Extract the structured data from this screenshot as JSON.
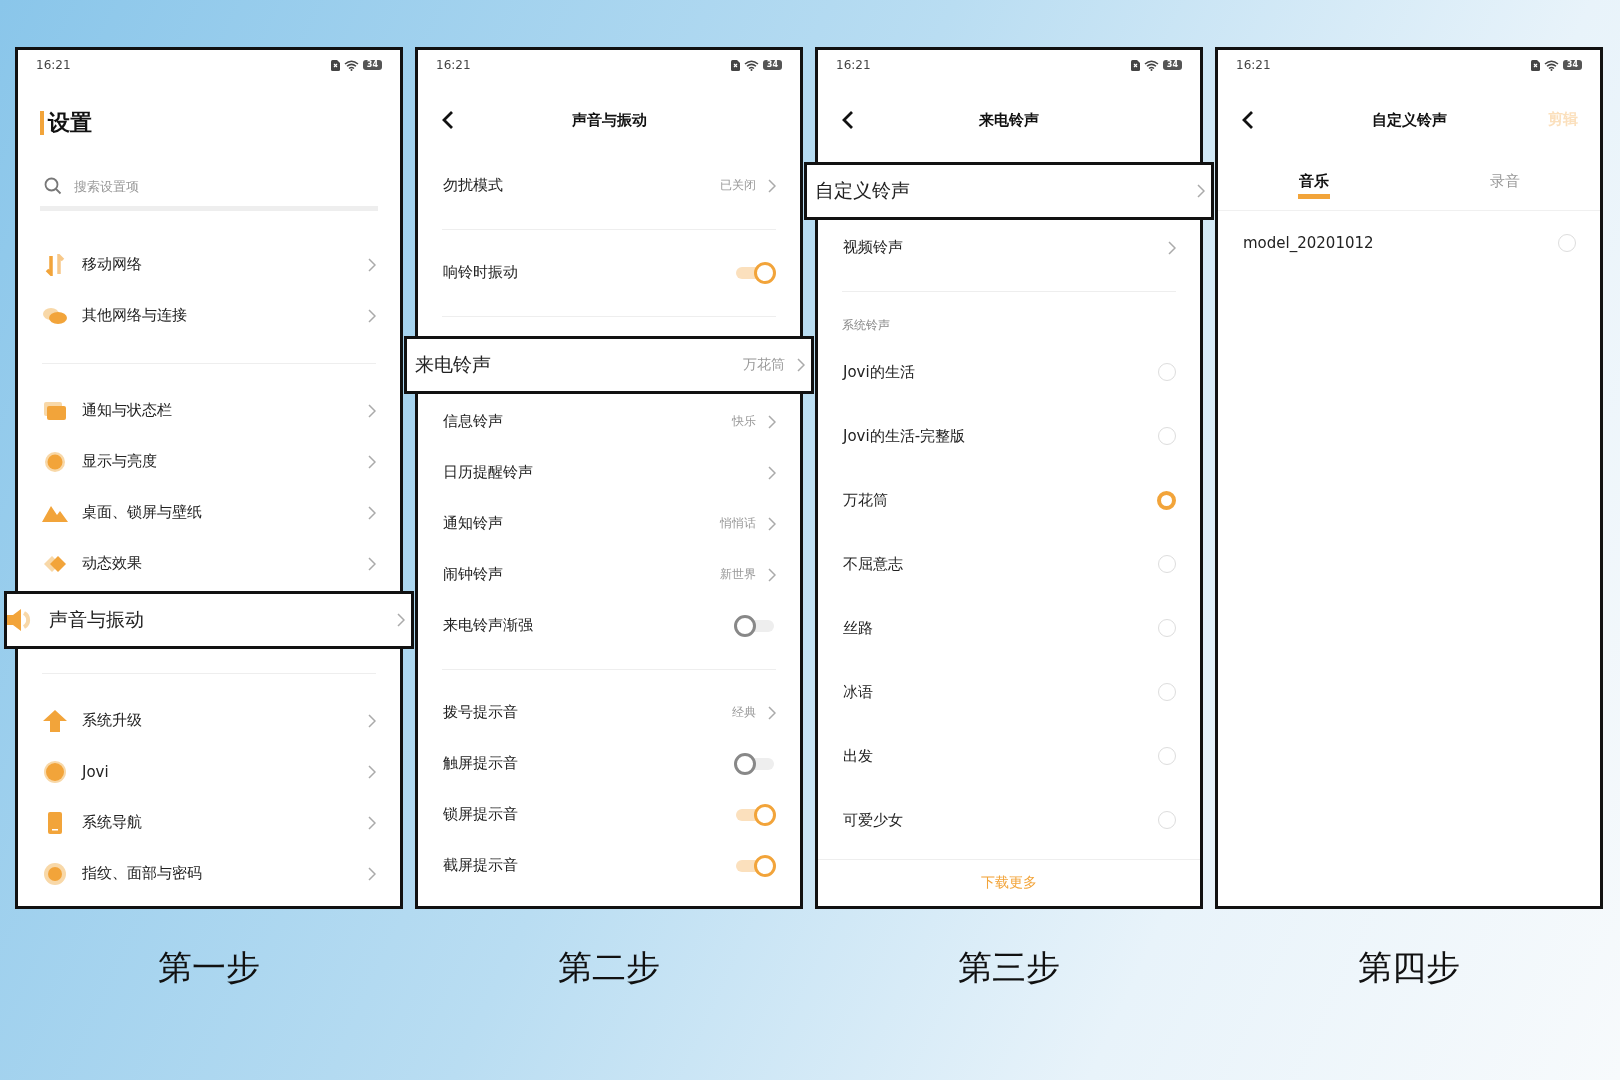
{
  "steps": [
    {
      "caption": "第一步",
      "phone": {
        "kind": "home",
        "status_bar": {
          "time": "16:21",
          "battery": "34"
        },
        "title": "设置",
        "search": {
          "placeholder": "搜索设置项"
        },
        "rows": [
          {
            "kind": "nav",
            "label": "移动网络",
            "highlighted": false
          },
          {
            "kind": "nav",
            "label": "其他网络与连接",
            "highlighted": false
          },
          {
            "kind": "divider"
          },
          {
            "kind": "nav",
            "label": "通知与状态栏",
            "highlighted": false
          },
          {
            "kind": "nav",
            "label": "显示与亮度",
            "highlighted": false
          },
          {
            "kind": "nav",
            "label": "桌面、锁屏与壁纸",
            "highlighted": false
          },
          {
            "kind": "nav",
            "label": "动态效果",
            "highlighted": false
          },
          {
            "kind": "nav",
            "label": "声音与振动",
            "highlighted": true
          },
          {
            "kind": "divider"
          },
          {
            "kind": "nav",
            "label": "系统升级",
            "highlighted": false
          },
          {
            "kind": "nav",
            "label": "Jovi",
            "highlighted": false
          },
          {
            "kind": "nav",
            "label": "系统导航",
            "highlighted": false
          },
          {
            "kind": "nav",
            "label": "指纹、面部与密码",
            "highlighted": false
          }
        ]
      }
    },
    {
      "caption": "第二步",
      "phone": {
        "kind": "page",
        "status_bar": {
          "time": "16:21",
          "battery": "34"
        },
        "title": "声音与振动",
        "rows": [
          {
            "kind": "nav",
            "label": "勿扰模式",
            "value": "已关闭",
            "highlighted": false
          },
          {
            "kind": "divider"
          },
          {
            "kind": "toggle",
            "label": "响铃时振动",
            "on": true,
            "highlighted": false
          },
          {
            "kind": "divider"
          },
          {
            "kind": "nav",
            "label": "来电铃声",
            "value": "万花筒",
            "highlighted": true
          },
          {
            "kind": "nav",
            "label": "信息铃声",
            "value": "快乐",
            "highlighted": false
          },
          {
            "kind": "nav",
            "label": "日历提醒铃声",
            "highlighted": false
          },
          {
            "kind": "nav",
            "label": "通知铃声",
            "value": "悄悄话",
            "highlighted": false
          },
          {
            "kind": "nav",
            "label": "闹钟铃声",
            "value": "新世界",
            "highlighted": false
          },
          {
            "kind": "toggle",
            "label": "来电铃声渐强",
            "on": false,
            "highlighted": false
          },
          {
            "kind": "divider"
          },
          {
            "kind": "nav",
            "label": "拨号提示音",
            "value": "经典",
            "highlighted": false
          },
          {
            "kind": "toggle",
            "label": "触屏提示音",
            "on": false,
            "highlighted": false
          },
          {
            "kind": "toggle",
            "label": "锁屏提示音",
            "on": true,
            "highlighted": false
          },
          {
            "kind": "toggle",
            "label": "截屏提示音",
            "on": true,
            "highlighted": false
          }
        ]
      }
    },
    {
      "caption": "第三步",
      "phone": {
        "kind": "page",
        "status_bar": {
          "time": "16:21",
          "battery": "34"
        },
        "title": "来电铃声",
        "rows": [
          {
            "kind": "nav",
            "label": "自定义铃声",
            "highlighted": true
          },
          {
            "kind": "nav",
            "label": "视频铃声",
            "highlighted": false
          },
          {
            "kind": "divider"
          },
          {
            "kind": "section",
            "label": "系统铃声"
          },
          {
            "kind": "radio",
            "label": "Jovi的生活",
            "selected": false,
            "highlighted": false
          },
          {
            "kind": "radio",
            "label": "Jovi的生活-完整版",
            "selected": false,
            "highlighted": false
          },
          {
            "kind": "radio",
            "label": "万花筒",
            "selected": true,
            "highlighted": false
          },
          {
            "kind": "radio",
            "label": "不屈意志",
            "selected": false,
            "highlighted": false
          },
          {
            "kind": "radio",
            "label": "丝路",
            "selected": false,
            "highlighted": false
          },
          {
            "kind": "radio",
            "label": "冰语",
            "selected": false,
            "highlighted": false
          },
          {
            "kind": "radio",
            "label": "出发",
            "selected": false,
            "highlighted": false
          },
          {
            "kind": "radio",
            "label": "可爱少女",
            "selected": false,
            "highlighted": false
          },
          {
            "kind": "footer",
            "label": "下载更多"
          }
        ]
      }
    },
    {
      "caption": "第四步",
      "phone": {
        "kind": "page",
        "status_bar": {
          "time": "16:21",
          "battery": "34"
        },
        "title": "自定义铃声",
        "action": {
          "label": "剪辑",
          "disabled": true
        },
        "tabs": [
          {
            "label": "音乐",
            "selected": true
          },
          {
            "label": "录音",
            "selected": false
          }
        ],
        "rows": [
          {
            "kind": "radio",
            "label": "model_20201012",
            "selected": false,
            "highlighted": false
          }
        ]
      }
    }
  ]
}
